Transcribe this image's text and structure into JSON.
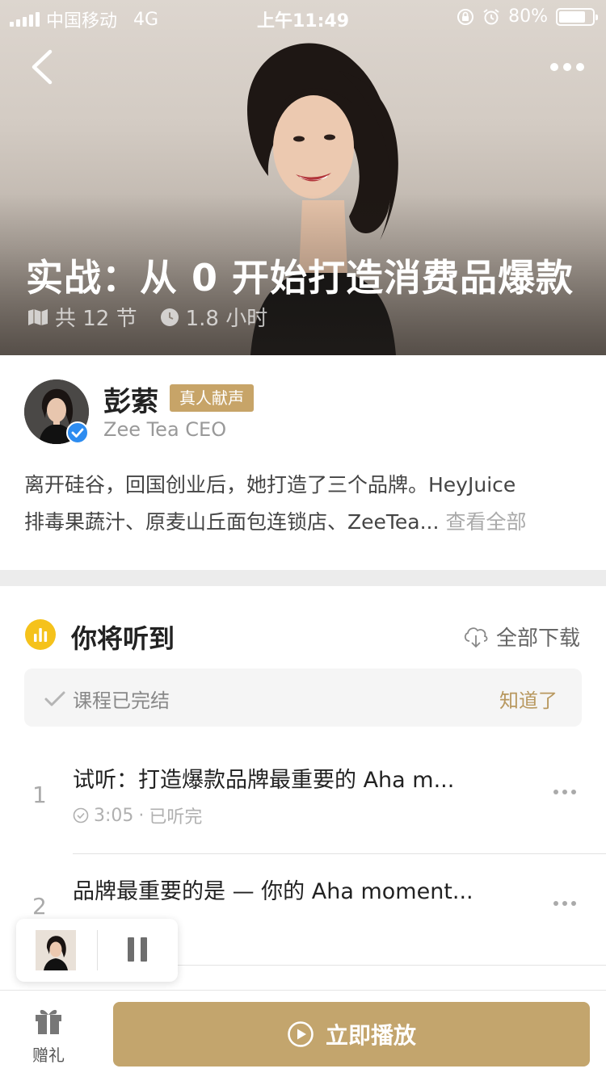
{
  "status_bar": {
    "carrier": "中国移动",
    "network": "4G",
    "time": "上午11:49",
    "battery": "80%"
  },
  "hero": {
    "title": "实战：从 0 开始打造消费品爆款",
    "lessons": "共 12 节",
    "duration": "1.8 小时"
  },
  "author": {
    "name": "彭萦",
    "badge": "真人献声",
    "title": "Zee Tea CEO",
    "desc_line1": "离开硅谷，回国创业后，她打造了三个品牌。HeyJuice",
    "desc_line2": "排毒果蔬汁、原麦山丘面包连锁店、ZeeTea...",
    "see_all": "查看全部"
  },
  "section": {
    "title": "你将听到",
    "download_all": "全部下载"
  },
  "notice": {
    "text": "课程已完结",
    "button": "知道了"
  },
  "lessons": [
    {
      "num": "1",
      "title": "试听：打造爆款品牌最重要的 Aha m...",
      "duration": "3:05",
      "sep": "·",
      "status": "已听完"
    },
    {
      "num": "2",
      "title": "品牌最重要的是 — 你的 Aha moment...",
      "duration": "",
      "sep": "",
      "status": "已听完"
    }
  ],
  "bottom": {
    "gift": "赠礼",
    "play": "立即播放"
  },
  "colors": {
    "gold": "#c3a56d",
    "badge_gold": "#c7a468",
    "accent_yellow": "#f5c21b",
    "verified_blue": "#2d8cf0"
  }
}
